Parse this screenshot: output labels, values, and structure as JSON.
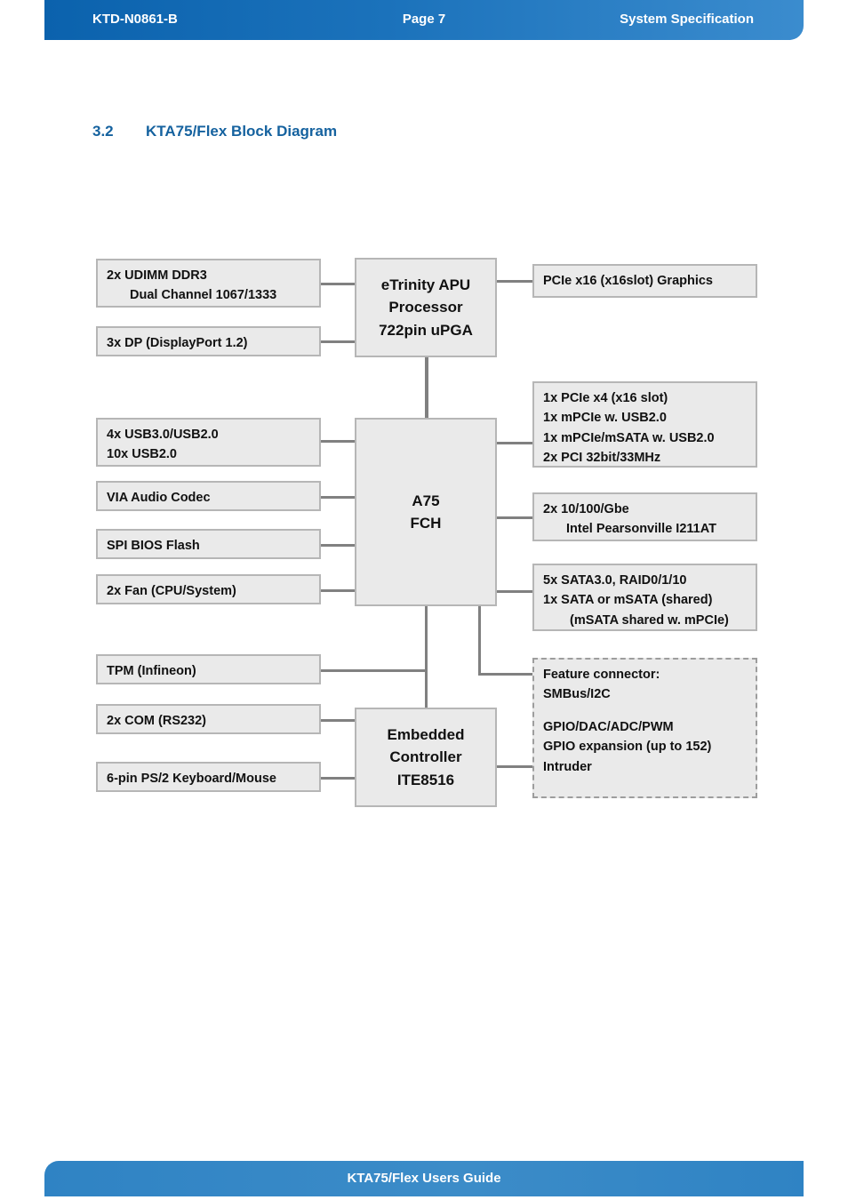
{
  "header": {
    "doc_id": "KTD-N0861-B",
    "page": "Page 7",
    "section": "System Specification"
  },
  "footer": {
    "text": "KTA75/Flex Users Guide"
  },
  "heading": {
    "number": "3.2",
    "title": "KTA75/Flex Block Diagram"
  },
  "colors": {
    "header_blue_dark": "#0b62ad",
    "header_blue_light": "#3b8cce",
    "footer_blue": "#3c8cc8",
    "heading_blue": "#15629f",
    "node_fill": "#eaeaea",
    "node_border": "#b6b6b6",
    "wire": "#808080"
  },
  "diagram": {
    "type": "block-diagram",
    "title": "KTA75/Flex Block Diagram",
    "nodes": {
      "udimm": {
        "lines": [
          "2x UDIMM DDR3",
          "Dual Channel 1067/1333"
        ]
      },
      "displayport": {
        "lines": [
          "3x DP (DisplayPort 1.2)"
        ]
      },
      "apu": {
        "lines": [
          "eTrinity APU",
          "Processor",
          "722pin uPGA"
        ]
      },
      "pcie_graphics": {
        "lines": [
          "PCIe x16 (x16slot) Graphics"
        ]
      },
      "usb": {
        "lines": [
          "4x USB3.0/USB2.0",
          "10x USB2.0"
        ]
      },
      "audio": {
        "lines": [
          "VIA Audio Codec"
        ]
      },
      "spi_bios": {
        "lines": [
          "SPI BIOS Flash"
        ]
      },
      "fan": {
        "lines": [
          "2x Fan (CPU/System)"
        ]
      },
      "fch": {
        "lines": [
          "A75",
          "FCH"
        ]
      },
      "pcie_expansion": {
        "lines": [
          "1x PCIe x4 (x16 slot)",
          "1x mPCIe w. USB2.0",
          "1x mPCIe/mSATA w. USB2.0",
          "2x PCI 32bit/33MHz"
        ]
      },
      "ethernet": {
        "lines": [
          "2x 10/100/Gbe",
          "Intel Pearsonville I211AT"
        ]
      },
      "sata": {
        "lines": [
          "5x SATA3.0, RAID0/1/10",
          "1x SATA or mSATA (shared)",
          "(mSATA shared w. mPCIe)"
        ]
      },
      "tpm": {
        "lines": [
          "TPM (Infineon)"
        ]
      },
      "com": {
        "lines": [
          "2x COM (RS232)"
        ]
      },
      "ps2": {
        "lines": [
          "6-pin PS/2 Keyboard/Mouse"
        ]
      },
      "ec": {
        "lines": [
          "Embedded",
          "Controller",
          "ITE8516"
        ]
      },
      "feature_connector": {
        "lines": [
          "Feature connector:",
          "SMBus/I2C",
          "",
          "GPIO/DAC/ADC/PWM",
          "GPIO expansion (up to 152)",
          "Intruder"
        ]
      }
    }
  }
}
